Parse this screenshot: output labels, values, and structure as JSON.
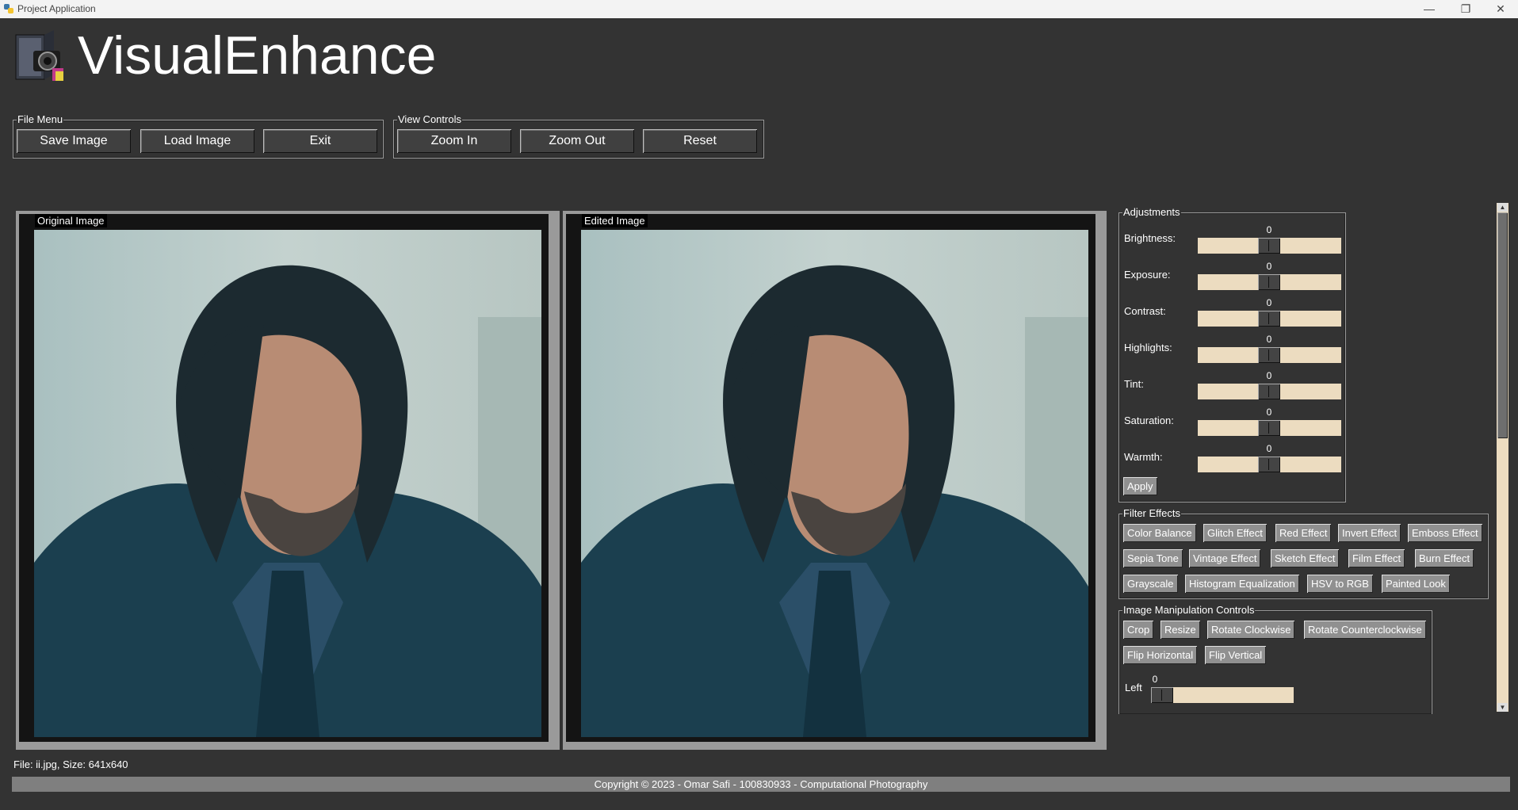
{
  "window": {
    "title": "Project Application",
    "controls": [
      "—",
      "❐",
      "✕"
    ]
  },
  "header": {
    "app_name": "VisualEnhance"
  },
  "file_menu": {
    "label": "File Menu",
    "buttons": [
      "Save Image",
      "Load Image",
      "Exit"
    ]
  },
  "view_controls": {
    "label": "View Controls",
    "buttons": [
      "Zoom In",
      "Zoom Out",
      "Reset"
    ]
  },
  "original": {
    "label": "Original Image"
  },
  "edited": {
    "label": "Edited Image"
  },
  "adjustments": {
    "label": "Adjustments",
    "sliders": [
      {
        "label": "Brightness:",
        "value": "0"
      },
      {
        "label": "Exposure:",
        "value": "0"
      },
      {
        "label": "Contrast:",
        "value": "0"
      },
      {
        "label": "Highlights:",
        "value": "0"
      },
      {
        "label": "Tint:",
        "value": "0"
      },
      {
        "label": "Saturation:",
        "value": "0"
      },
      {
        "label": "Warmth:",
        "value": "0"
      }
    ],
    "apply_label": "Apply"
  },
  "filters": {
    "label": "Filter Effects",
    "rows": [
      [
        "Color Balance",
        "Glitch Effect",
        "Red Effect",
        "Invert Effect",
        "Emboss Effect"
      ],
      [
        "Sepia Tone",
        "Vintage Effect",
        "Sketch Effect",
        "Film Effect",
        "Burn Effect"
      ],
      [
        "Grayscale",
        "Histogram Equalization",
        "HSV to RGB",
        "Painted Look"
      ]
    ]
  },
  "manipulation": {
    "label": "Image Manipulation Controls",
    "rows": [
      [
        "Crop",
        "Resize",
        "Rotate Clockwise",
        "Rotate Counterclockwise"
      ],
      [
        "Flip Horizontal",
        "Flip Vertical"
      ]
    ],
    "crop_left": {
      "label": "Left",
      "value": "0"
    }
  },
  "status": {
    "text": "File: ii.jpg, Size: 641x640"
  },
  "footer": {
    "text": "Copyright © 2023 - Omar Safi - 100830933 - Computational Photography"
  },
  "colors": {
    "background": "#333333",
    "slider_track": "#ecdcc0",
    "footer_bar": "#7f7f7f"
  }
}
